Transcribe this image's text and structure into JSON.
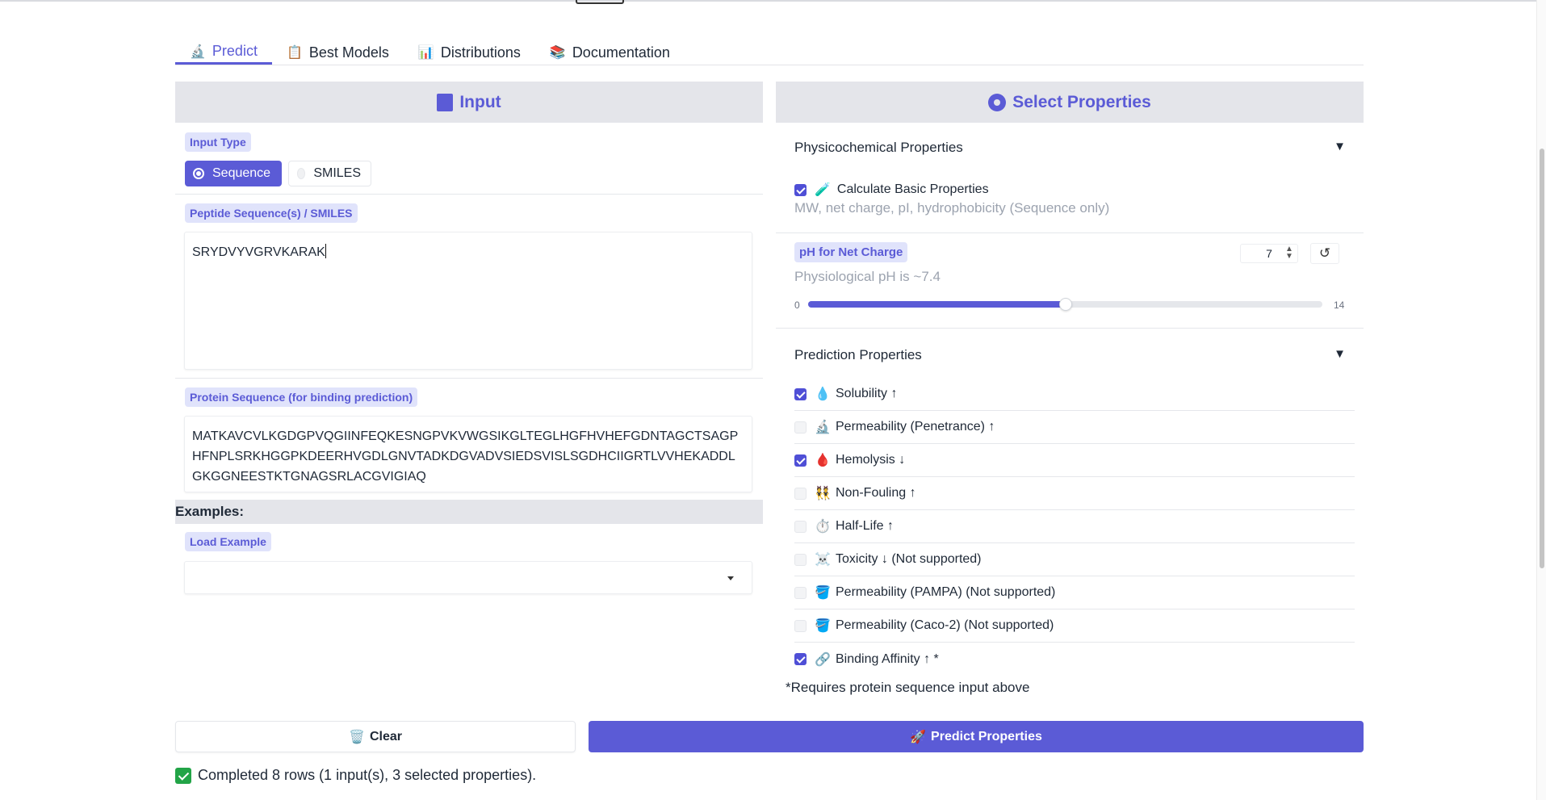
{
  "tabs": [
    {
      "label": "Predict",
      "icon": "microscope-icon",
      "glyph": "🔬"
    },
    {
      "label": "Best Models",
      "icon": "clipboard-icon",
      "glyph": "📋"
    },
    {
      "label": "Distributions",
      "icon": "bar-chart-icon",
      "glyph": "📊"
    },
    {
      "label": "Documentation",
      "icon": "books-icon",
      "glyph": "📚"
    }
  ],
  "input_panel": {
    "title": "Input",
    "input_type_label": "Input Type",
    "input_type_options": [
      "Sequence",
      "SMILES"
    ],
    "input_type_selected": "Sequence",
    "peptide_label": "Peptide Sequence(s) / SMILES",
    "peptide_value": "SRYDVYVGRVKARAK",
    "protein_label": "Protein Sequence (for binding prediction)",
    "protein_value": "MATKAVCVLKGDGPVQGIINFEQKESNGPVKVWGSIKGLTEGLHGFHVHEFGDNTAGCTSAGPHFNPLSRKHGGPKDEERHVGDLGNVTADKDGVADVSIEDSVISLSGDHCIIGRTLVVHEKADDLGKGGNEESTKTGNAGSRLACGVIGIAQ",
    "examples_heading": "Examples:",
    "load_example_label": "Load Example",
    "load_example_value": ""
  },
  "properties_panel": {
    "title": "Select Properties",
    "physico": {
      "title": "Physicochemical Properties",
      "arrow": "▼",
      "basic_label": "Calculate Basic Properties",
      "basic_checked": true,
      "basic_glyph": "🧪",
      "basic_info": "MW, net charge, pI, hydrophobicity (Sequence only)",
      "ph_label": "pH for Net Charge",
      "ph_info": "Physiological pH is ~7.4",
      "ph_value": "7",
      "ph_min": "0",
      "ph_max": "14",
      "ph_fraction": 0.5
    },
    "prediction": {
      "title": "Prediction Properties",
      "arrow": "▼",
      "items": [
        {
          "label": "Solubility ↑",
          "checked": true,
          "glyph": "💧",
          "icon": "droplet-icon"
        },
        {
          "label": "Permeability (Penetrance) ↑",
          "checked": false,
          "glyph": "🔬",
          "icon": "microscope-icon"
        },
        {
          "label": "Hemolysis ↓",
          "checked": true,
          "glyph": "🩸",
          "icon": "blood-drop-icon"
        },
        {
          "label": "Non-Fouling ↑",
          "checked": false,
          "glyph": "👯",
          "icon": "people-icon"
        },
        {
          "label": "Half-Life ↑",
          "checked": false,
          "glyph": "⏱️",
          "icon": "stopwatch-icon"
        },
        {
          "label": "Toxicity ↓ (Not supported)",
          "checked": false,
          "glyph": "☠️",
          "icon": "skull-icon"
        },
        {
          "label": "Permeability (PAMPA) (Not supported)",
          "checked": false,
          "glyph": "🪣",
          "icon": "bucket-icon"
        },
        {
          "label": "Permeability (Caco-2) (Not supported)",
          "checked": false,
          "glyph": "🪣",
          "icon": "bucket-icon"
        },
        {
          "label": "Binding Affinity ↑ *",
          "checked": true,
          "glyph": "🔗",
          "icon": "link-icon"
        }
      ],
      "footnote": "*Requires protein sequence input above"
    }
  },
  "actions": {
    "clear_label": "Clear",
    "clear_glyph": "🗑️",
    "predict_label": "Predict Properties",
    "predict_glyph": "🚀"
  },
  "status": {
    "text": "Completed 8 rows (1 input(s), 3 selected properties)."
  },
  "colors": {
    "accent": "#5b5bd6",
    "header_bg": "#e4e5ea",
    "success": "#22a447"
  }
}
